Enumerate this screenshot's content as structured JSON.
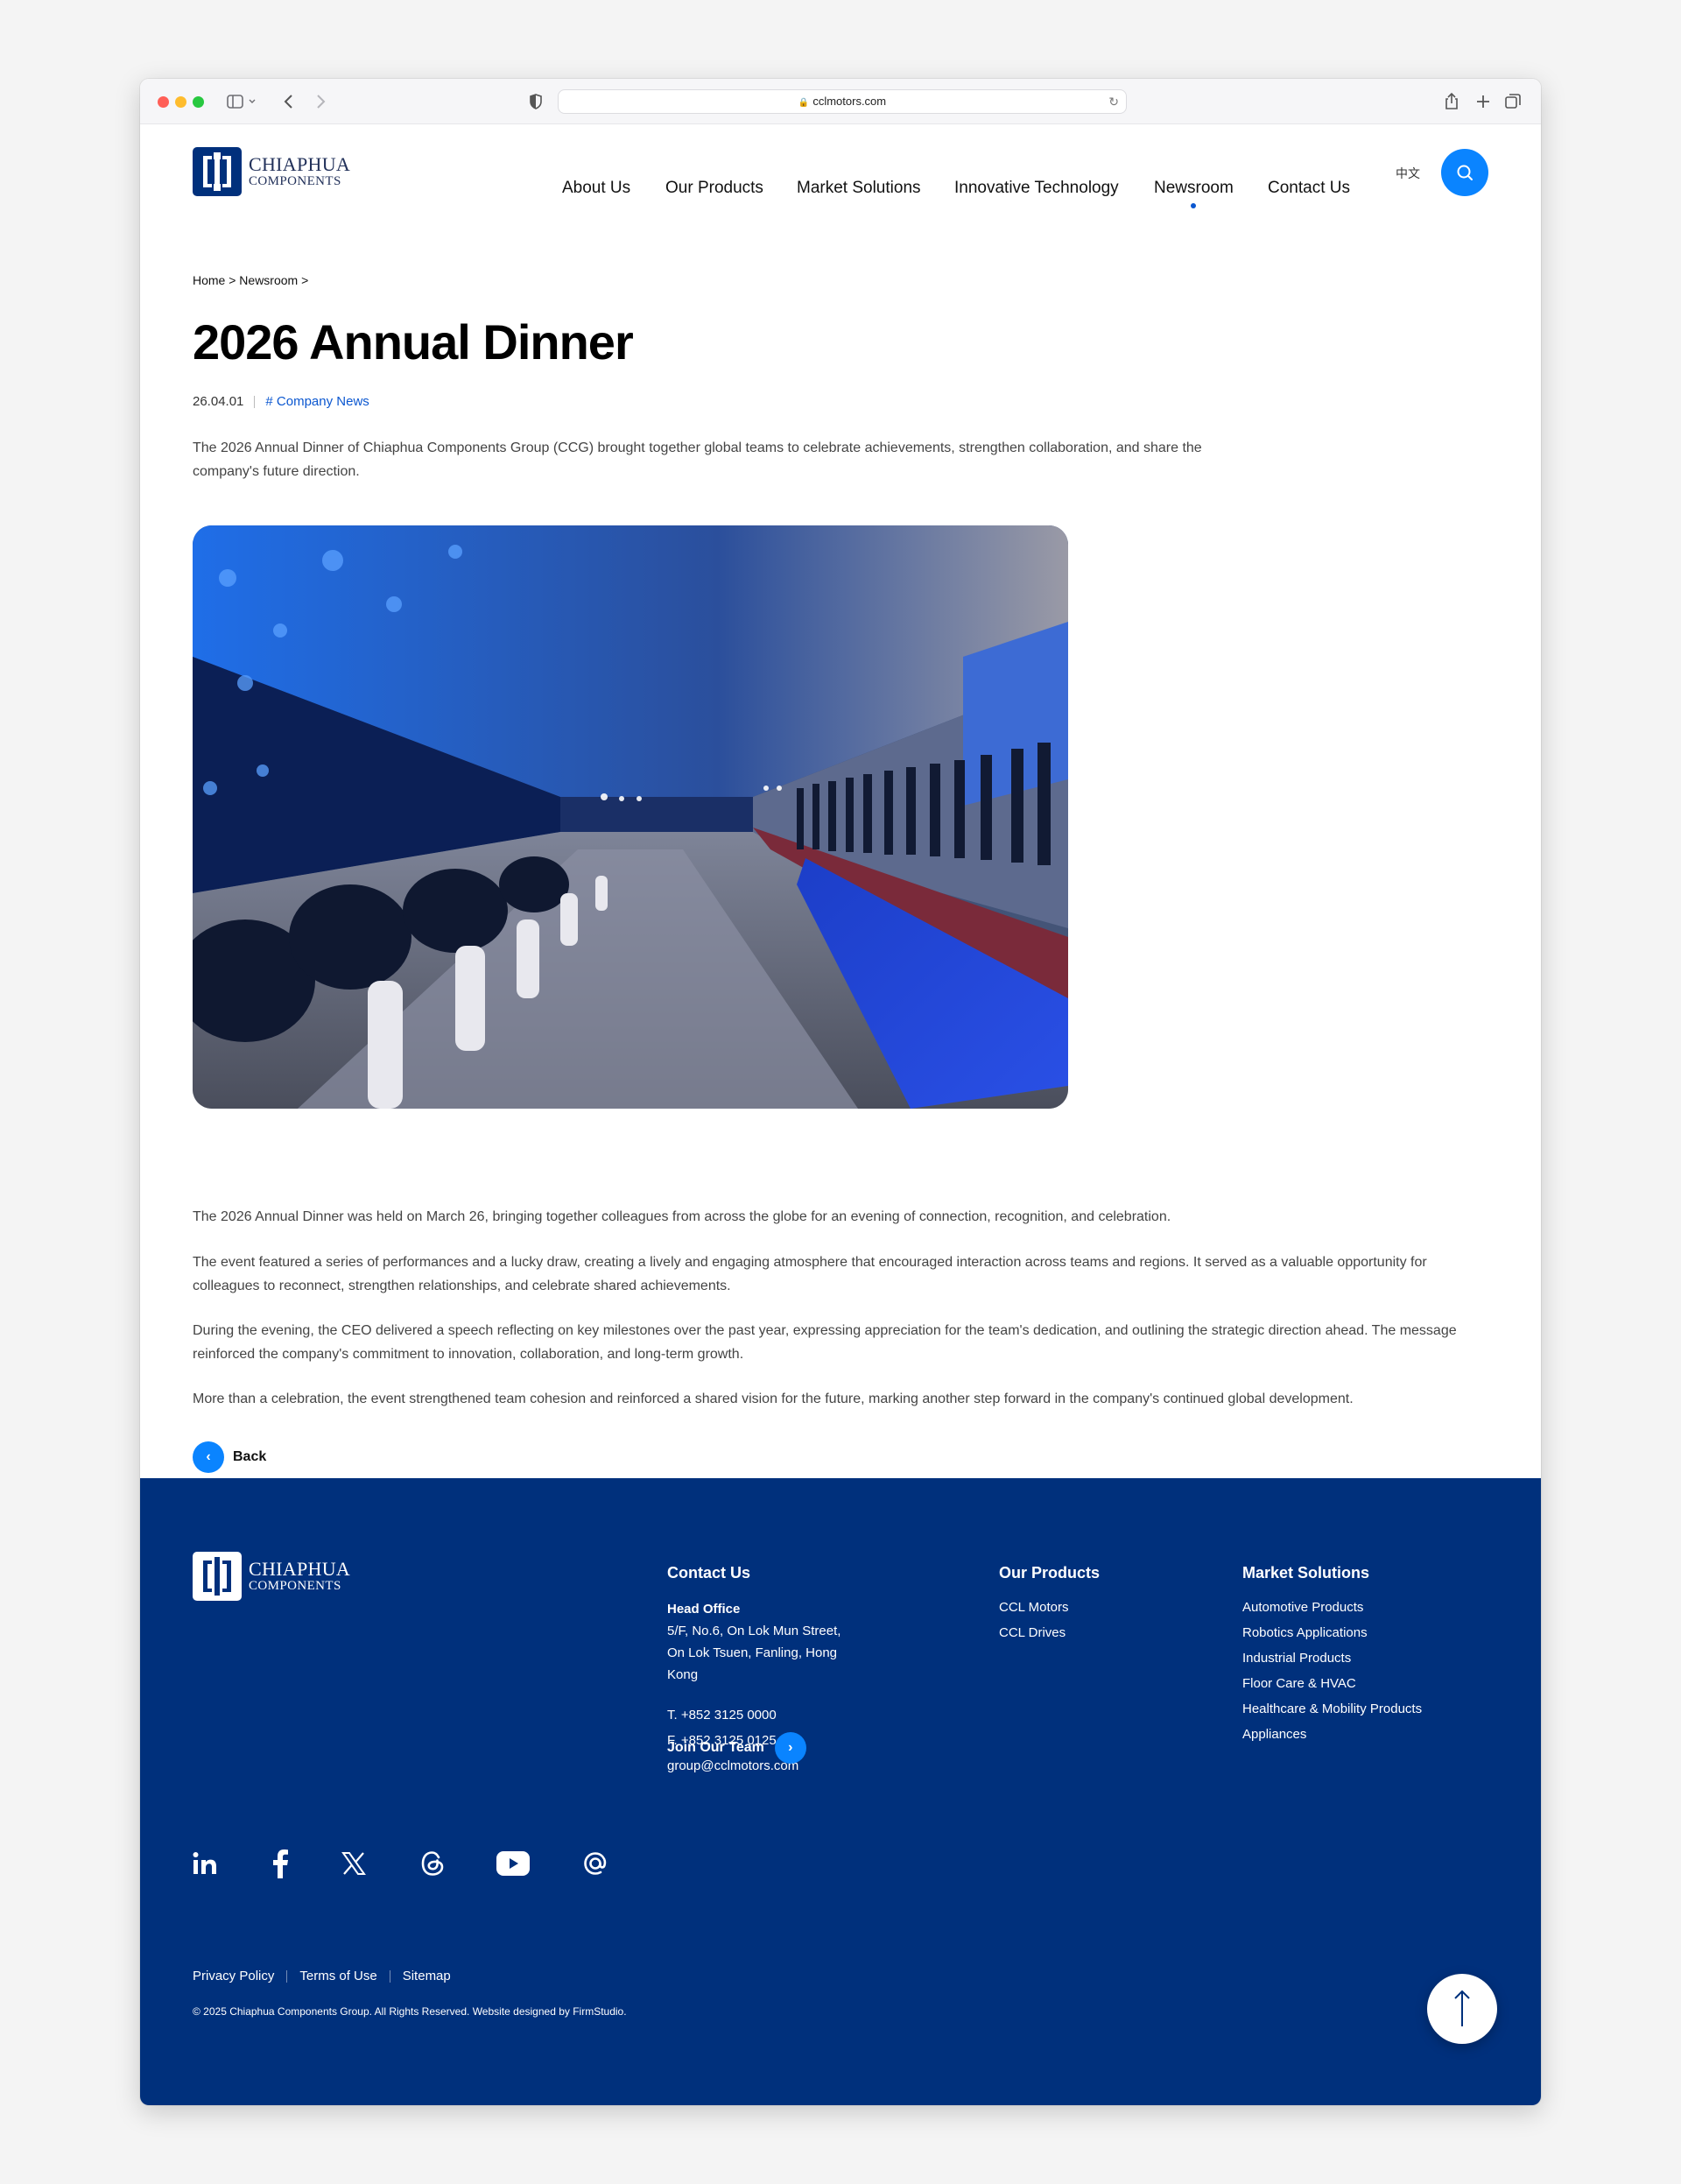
{
  "browser": {
    "url": "cclmotors.com"
  },
  "brand": {
    "name_line1": "CHIAPHUA",
    "name_line2": "COMPONENTS",
    "primary_color": "#00307c",
    "accent_color": "#0a84ff",
    "link_color": "#0b57d0"
  },
  "nav": {
    "items": [
      {
        "label": "About Us",
        "active": false
      },
      {
        "label": "Our Products",
        "active": false
      },
      {
        "label": "Market Solutions",
        "active": false
      },
      {
        "label": "Innovative Technology",
        "active": false
      },
      {
        "label": "Newsroom",
        "active": true
      },
      {
        "label": "Contact Us",
        "active": false
      }
    ],
    "language": "中文",
    "search_icon": "search-icon"
  },
  "article": {
    "breadcrumb": "Home > Newsroom >",
    "title": "2026 Annual Dinner",
    "date": "26.04.01",
    "tag": "# Company News",
    "intro": "The 2026 Annual Dinner of Chiaphua Components Group (CCG) brought together global teams to celebrate achievements, strengthen collaboration, and share the company's future direction.",
    "paragraphs": [
      "The 2026 Annual Dinner was held on March 26, bringing together colleagues from across the globe for an evening of connection, recognition, and celebration.",
      "The event featured a series of performances and a lucky draw, creating a lively and engaging atmosphere that encouraged interaction across teams and regions. It served as a valuable opportunity for colleagues to reconnect, strengthen relationships, and celebrate shared achievements.",
      "During the evening, the CEO delivered a speech reflecting on key milestones over the past year, expressing appreciation for the team's dedication, and outlining the strategic direction ahead. The message reinforced the company's commitment to innovation, collaboration, and long-term growth.",
      "More than a celebration, the event strengthened team cohesion and reinforced a shared vision for the future, marking another step forward in the company's continued global development."
    ],
    "back_label": "Back"
  },
  "footer": {
    "contact": {
      "heading": "Contact Us",
      "office_label": "Head Office",
      "address_lines": [
        "5/F, No.6, On Lok Mun Street,",
        "On Lok Tsuen, Fanling, Hong",
        "Kong"
      ],
      "phone": "T. +852 3125 0000",
      "fax": "F. +852 3125 0125",
      "email": "group@cclmotors.com",
      "join_label": "Join Our Team"
    },
    "products": {
      "heading": "Our Products",
      "items": [
        "CCL Motors",
        "CCL Drives"
      ]
    },
    "solutions": {
      "heading": "Market Solutions",
      "items": [
        "Automotive Products",
        "Robotics Applications",
        "Industrial Products",
        "Floor Care & HVAC",
        "Healthcare & Mobility Products",
        "Appliances"
      ]
    },
    "social_icons": [
      "linkedin-icon",
      "facebook-icon",
      "x-icon",
      "threads-icon",
      "youtube-icon",
      "at-sign-icon"
    ],
    "legal_links": [
      "Privacy Policy",
      "Terms of Use",
      "Sitemap"
    ],
    "copyright": "© 2025 Chiaphua Components Group. All Rights Reserved.  Website designed by FirmStudio."
  }
}
